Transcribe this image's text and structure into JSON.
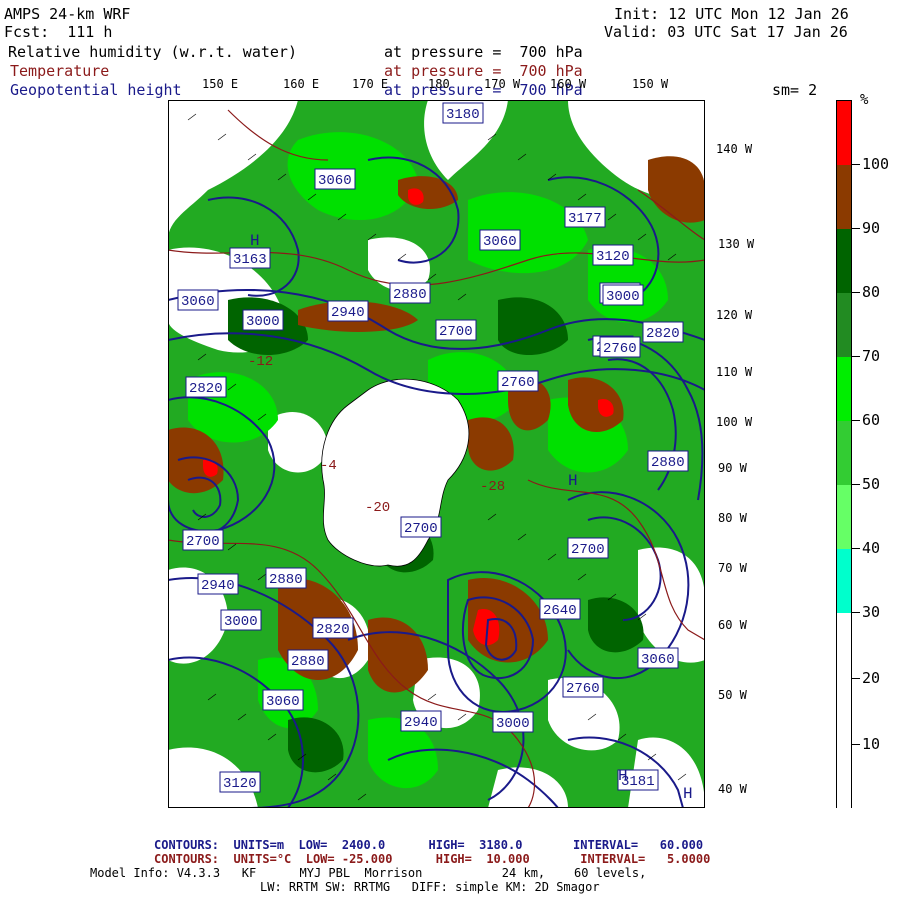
{
  "header": {
    "model": "AMPS 24-km WRF",
    "fcst": "Fcst:  111 h",
    "init": "Init: 12 UTC Mon 12 Jan 26",
    "valid": "Valid: 03 UTC Sat 17 Jan 26",
    "fields": [
      {
        "name": "Relative humidity (w.r.t. water)",
        "level": "at pressure =  700 hPa",
        "color": "#000000"
      },
      {
        "name": "Temperature",
        "level": "at pressure =  700 hPa",
        "color": "#8b1a1a"
      },
      {
        "name": "Geopotential height",
        "level": "at pressure =  700 hPa",
        "color": "#1a1a8a"
      }
    ],
    "sm": "sm= 2"
  },
  "map": {
    "top_lon_labels": [
      "150 E",
      "160 E",
      "170 E",
      "180",
      "170 W",
      "160 W",
      "150 W"
    ],
    "right_lon_labels": [
      "140 W",
      "130 W",
      "120 W",
      "110 W",
      "100 W",
      "90 W",
      "80 W",
      "70 W",
      "60 W",
      "50 W",
      "40 W"
    ],
    "height_labels": [
      "3060",
      "3163",
      "3000",
      "3060",
      "2940",
      "2880",
      "2760",
      "2700",
      "2640",
      "2820",
      "3000",
      "2700",
      "2880",
      "2940",
      "3000",
      "3060",
      "3120",
      "3180",
      "2760",
      "2820",
      "3000",
      "3120",
      "3177",
      "3060",
      "2700",
      "2640",
      "2760",
      "2880",
      "3060",
      "3000",
      "2940",
      "2880",
      "2820",
      "2700",
      "3181"
    ],
    "high_markers": [
      "H",
      "H",
      "H",
      "H"
    ],
    "temp_labels": [
      "-4",
      "-20",
      "-28",
      "-12"
    ]
  },
  "legend": {
    "unit": "%",
    "labels": [
      "100",
      "90",
      "80",
      "70",
      "60",
      "50",
      "40",
      "30",
      "20",
      "10"
    ],
    "colors": [
      "#ff0000",
      "#8b3a00",
      "#006400",
      "#228b22",
      "#00ee00",
      "#33cc33",
      "#66ff66",
      "#00ffcc",
      "#ffffff",
      "#ffffff",
      "#ffffff"
    ]
  },
  "footer": {
    "contours_height": "CONTOURS:  UNITS=m  LOW=  2400.0      HIGH=  3180.0       INTERVAL=   60.000",
    "contours_temp": "CONTOURS:  UNITS=°C  LOW= -25.000      HIGH=  10.000       INTERVAL=   5.0000",
    "model_info_1": "Model Info: V4.3.3   KF      MYJ PBL  Morrison           24 km,    60 levels,",
    "model_info_2": "LW: RRTM SW: RRTMG   DIFF: simple KM: 2D Smagor"
  }
}
